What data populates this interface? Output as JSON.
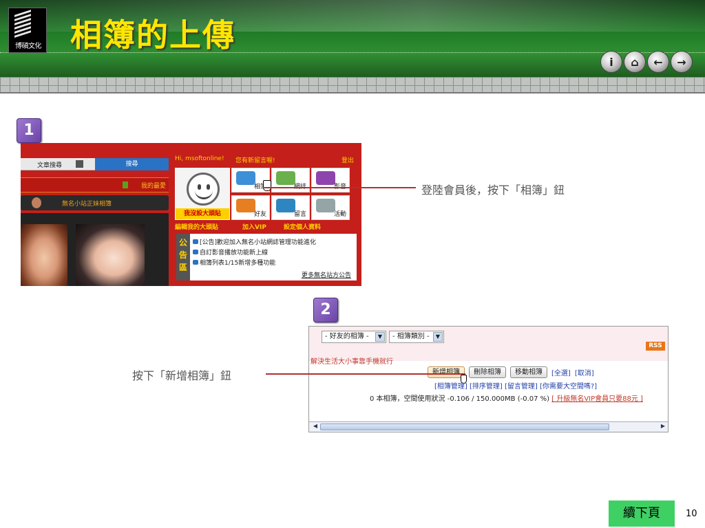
{
  "slide": {
    "title": "相簿的上傳",
    "logo_text": "博碩文化",
    "continue_label": "續下頁",
    "page_number": "10",
    "nav_buttons": [
      {
        "icon": "info-icon",
        "glyph": "i"
      },
      {
        "icon": "home-icon",
        "glyph": "⌂"
      },
      {
        "icon": "back-icon",
        "glyph": "←"
      },
      {
        "icon": "forward-icon",
        "glyph": "→"
      }
    ]
  },
  "steps": {
    "step1_num": "1",
    "step2_num": "2",
    "step1_note": "登陸會員後，按下「相簿」鈕",
    "step2_note": "按下「新增相簿」鈕"
  },
  "screenshot1": {
    "search_select": "文章搜尋",
    "search_button": "搜尋",
    "top_user": "Hi, msoftonline!",
    "top_message": "您有新留言喔!",
    "top_logout": "登出",
    "strip_right": "我的最愛",
    "dark_bar": "無名小站正妹相簿",
    "big_tile_caption": "我沒設大頭貼",
    "tiles": [
      "相簿",
      "網誌",
      "影音",
      "好友",
      "留言",
      "活動"
    ],
    "links": [
      "編輯我的大頭貼",
      "加入VIP",
      "設定個人資料"
    ],
    "notice_label": "公告區",
    "notices": [
      "[公告]歡迎加入無名小站網誌管理功能進化",
      "自訂影音播放功能新上線",
      "相簿列表1/15新增多種功能"
    ],
    "notice_more": "更多無名站方公告"
  },
  "screenshot2": {
    "select_friends": "- 好友的相簿 -",
    "select_category": "- 相簿類別 -",
    "rss": "RSS",
    "message": "解決生活大小事靠手機就行",
    "buttons": {
      "new_album": "新增相簿",
      "delete_album": "刪除相簿",
      "move_album": "移動相簿"
    },
    "select_all": "[全選]",
    "cancel": "[取消]",
    "sub_links": "[相簿管理] [排序管理] [留言管理] [你需要大空間嗎?]",
    "status": "0 本相簿，空間使用狀況 -0.106 / 150.000MB (-0.07 %)",
    "upgrade": "[ 升級無名VIP會員只要88元 ]"
  }
}
